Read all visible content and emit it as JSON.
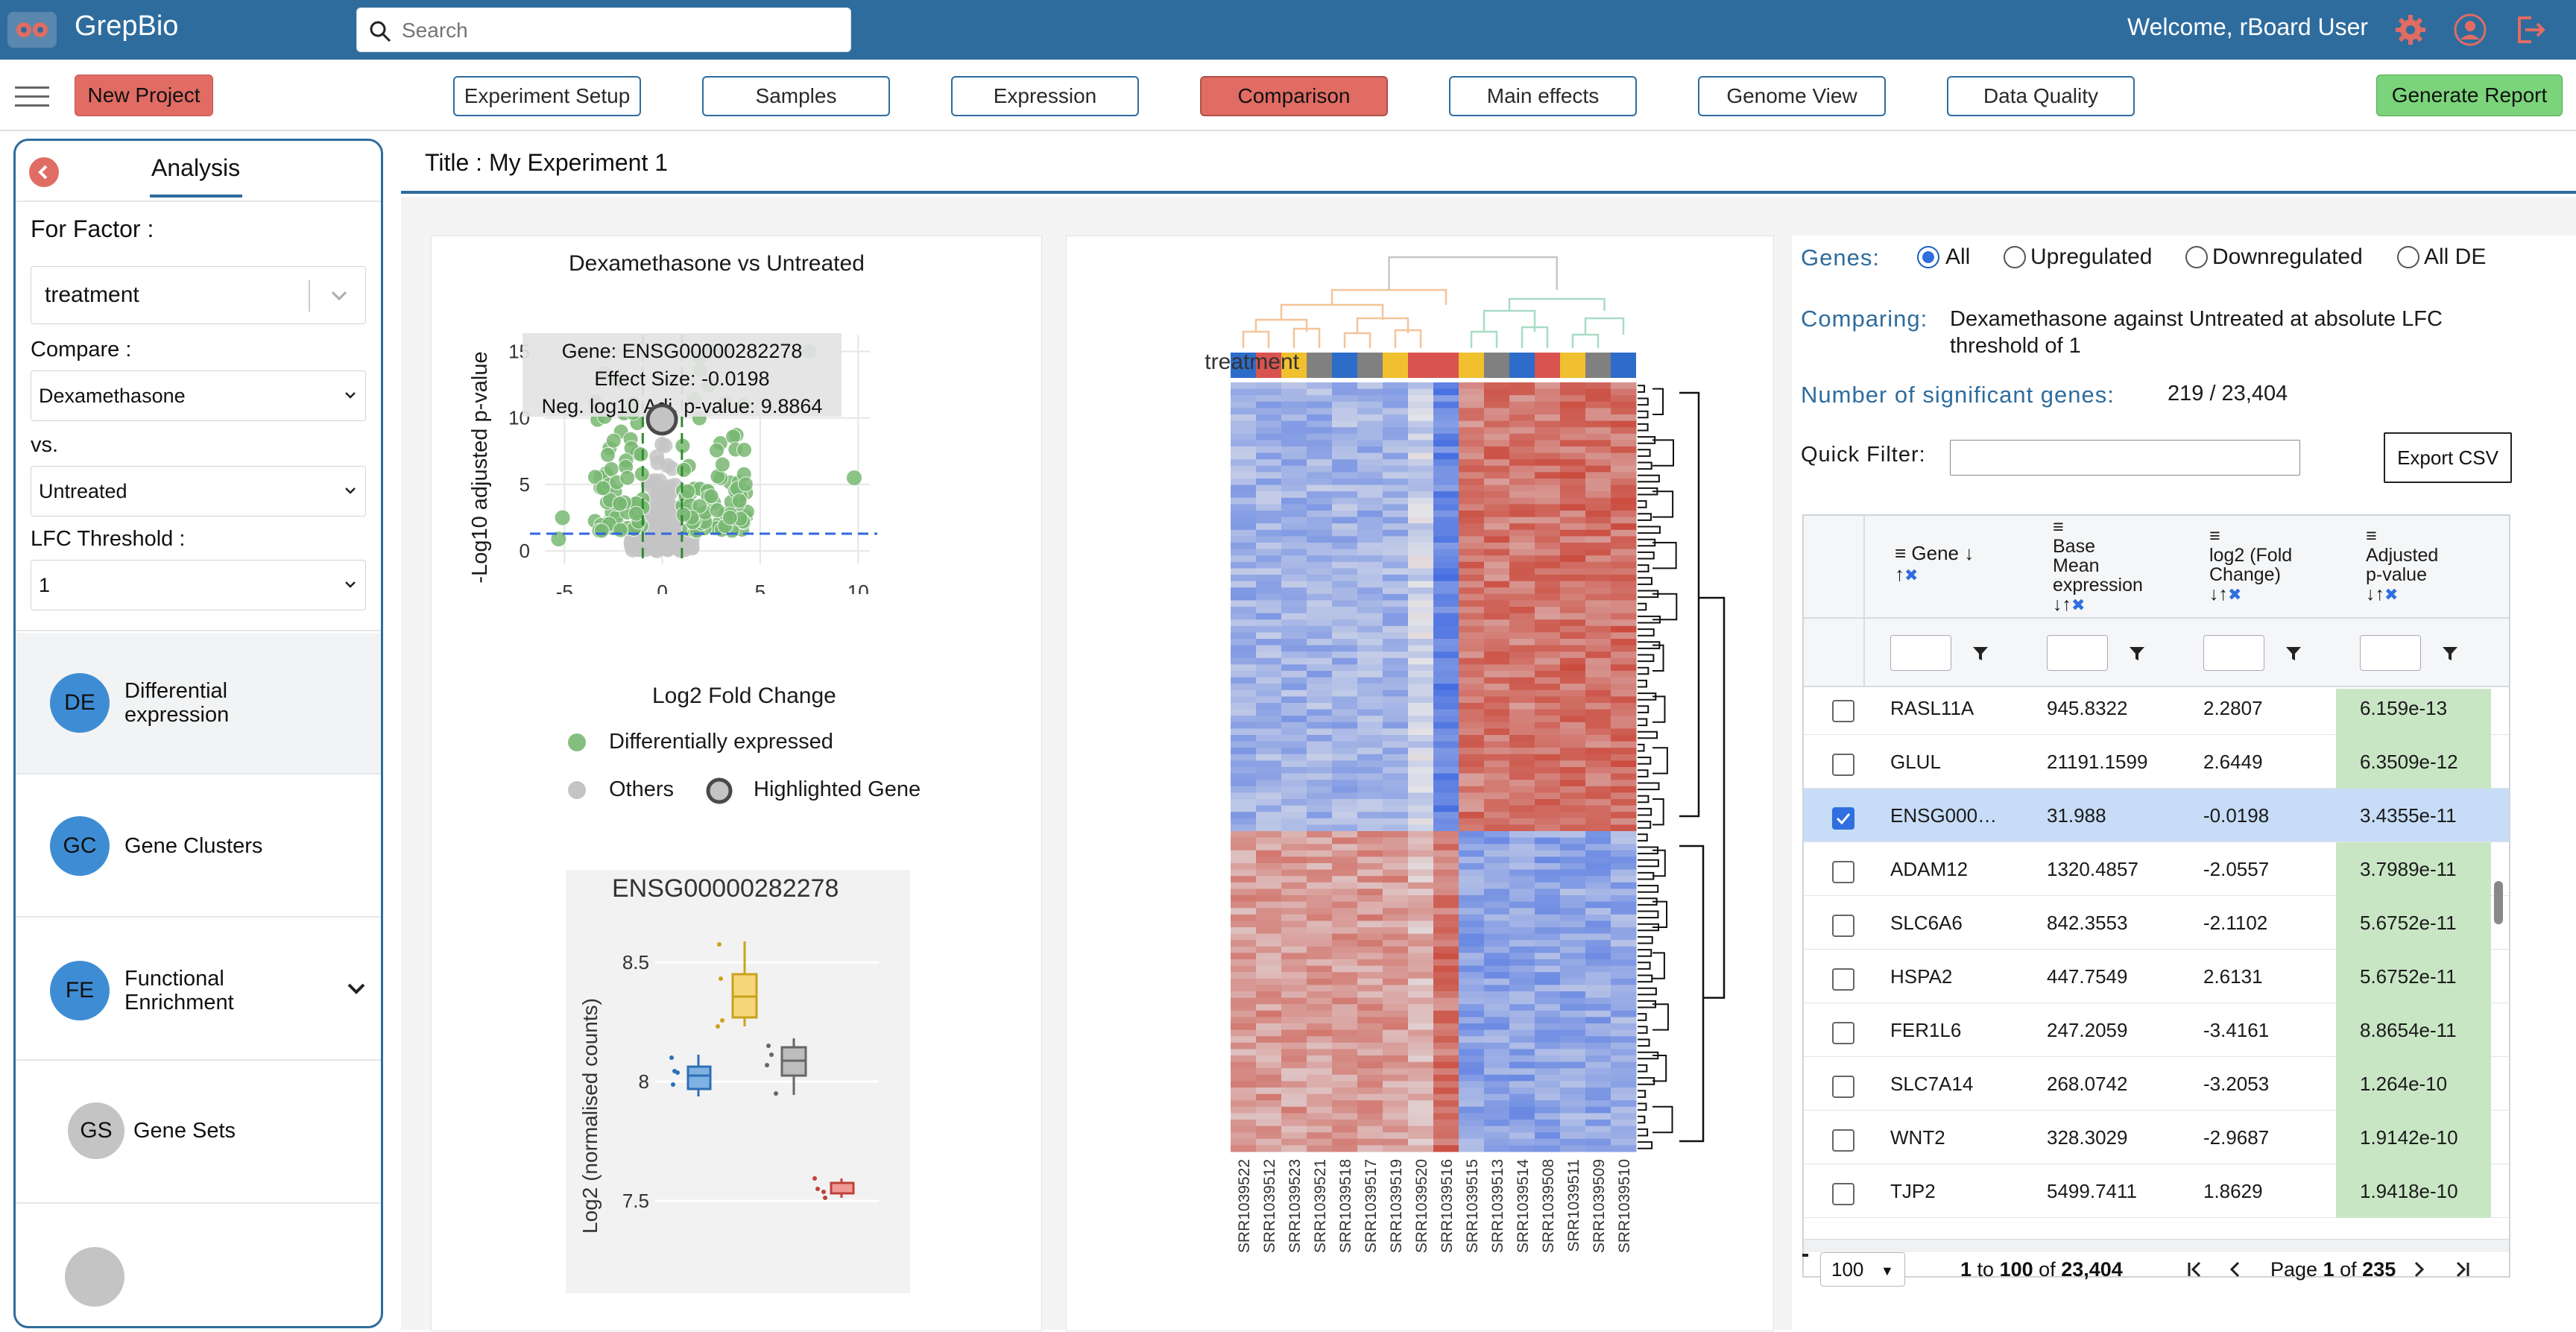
{
  "app": {
    "brand": "GrepBio",
    "welcome": "Welcome, rBoard User"
  },
  "search": {
    "placeholder": "Search"
  },
  "nav": {
    "new_project": "New Project",
    "generate_report": "Generate Report",
    "tabs": [
      {
        "label": "Experiment Setup"
      },
      {
        "label": "Samples"
      },
      {
        "label": "Expression"
      },
      {
        "label": "Comparison",
        "active": true
      },
      {
        "label": "Main effects"
      },
      {
        "label": "Genome View"
      },
      {
        "label": "Data Quality"
      }
    ]
  },
  "sidebar": {
    "title": "Analysis",
    "factor_label": "For Factor :",
    "factor_value": "treatment",
    "compare_label": "Compare :",
    "compare_value": "Dexamethasone",
    "vs_label": "vs.",
    "vs_value": "Untreated",
    "lfc_label": "LFC Threshold :",
    "lfc_value": "1",
    "items": [
      {
        "badge": "DE",
        "line1": "Differential",
        "line2": "expression"
      },
      {
        "badge": "GC",
        "line1": "Gene Clusters",
        "line2": ""
      },
      {
        "badge": "FE",
        "line1": "Functional",
        "line2": "Enrichment"
      },
      {
        "badge": "GS",
        "line1": "Gene Sets",
        "line2": ""
      }
    ]
  },
  "experiment": {
    "title": "Title : My Experiment 1"
  },
  "volcano": {
    "title": "Dexamethasone vs Untreated",
    "xlabel": "Log2 Fold Change",
    "ylabel": "-Log10 adjusted p-value",
    "xticks": [
      "-5",
      "0",
      "5",
      "10"
    ],
    "yticks": [
      "0",
      "5",
      "10",
      "15"
    ],
    "tooltip": {
      "gene": "Gene: ENSG00000282278",
      "effect": "Effect Size: -0.0198",
      "pval": "Neg. log10 Adj. p-value: 9.8864"
    },
    "legend": {
      "de": "Differentially expressed",
      "others": "Others",
      "highlighted": "Highlighted Gene"
    },
    "colors": {
      "de": "#78b872",
      "others": "#c4c4c4",
      "highlight": "#4a4a4a",
      "threshold_h": "#3366e0",
      "threshold_v": "#2e8b2e"
    }
  },
  "boxplot": {
    "title": "ENSG00000282278",
    "ylabel": "Log2 (normalised counts)",
    "yticks": [
      "7.5",
      "8",
      "8.5"
    ],
    "colors": [
      "#4a90d9",
      "#f2c744",
      "#9a9a9a",
      "#e06c63"
    ]
  },
  "heatmap": {
    "row_label": "treatment",
    "samples": [
      "SRR1039522",
      "SRR1039512",
      "SRR1039523",
      "SRR1039521",
      "SRR1039518",
      "SRR1039517",
      "SRR1039519",
      "SRR1039520",
      "SRR1039516",
      "SRR1039515",
      "SRR1039513",
      "SRR1039514",
      "SRR1039508",
      "SRR1039511",
      "SRR1039509",
      "SRR1039510"
    ],
    "annotation_colors": [
      "#2e6cc9",
      "#d9534f",
      "#f0c02f",
      "#808080",
      "#2e6cc9",
      "#808080",
      "#f0c02f",
      "#d9534f",
      "#d9534f",
      "#f0c02f",
      "#808080",
      "#2e6cc9",
      "#d9534f",
      "#f0c02f",
      "#808080",
      "#2e6cc9"
    ]
  },
  "results": {
    "genes_label": "Genes:",
    "filters": [
      {
        "label": "All",
        "checked": true
      },
      {
        "label": "Upregulated",
        "checked": false
      },
      {
        "label": "Downregulated",
        "checked": false
      },
      {
        "label": "All DE",
        "checked": false
      }
    ],
    "comparing_label": "Comparing:",
    "comparing_line1": "Dexamethasone against Untreated at absolute LFC",
    "comparing_line2": "threshold of 1",
    "sig_label": "Number of significant genes:",
    "sig_value": "219 / 23,404",
    "quick_filter_label": "Quick Filter:",
    "export_label": "Export CSV"
  },
  "table": {
    "headers": {
      "gene": "Gene",
      "base_mean": [
        "Base",
        "Mean",
        "expression"
      ],
      "log2fc": [
        "log2 (Fold",
        "Change)"
      ],
      "padj": [
        "Adjusted",
        "p-value"
      ]
    },
    "rows": [
      {
        "gene": "RASL11A",
        "base": "945.8322",
        "lfc": "2.2807",
        "padj": "6.159e-13",
        "sel": false
      },
      {
        "gene": "GLUL",
        "base": "21191.1599",
        "lfc": "2.6449",
        "padj": "6.3509e-12",
        "sel": false
      },
      {
        "gene": "ENSG000…",
        "base": "31.988",
        "lfc": "-0.0198",
        "padj": "3.4355e-11",
        "sel": true
      },
      {
        "gene": "ADAM12",
        "base": "1320.4857",
        "lfc": "-2.0557",
        "padj": "3.7989e-11",
        "sel": false
      },
      {
        "gene": "SLC6A6",
        "base": "842.3553",
        "lfc": "-2.1102",
        "padj": "5.6752e-11",
        "sel": false
      },
      {
        "gene": "HSPA2",
        "base": "447.7549",
        "lfc": "2.6131",
        "padj": "5.6752e-11",
        "sel": false
      },
      {
        "gene": "FER1L6",
        "base": "247.2059",
        "lfc": "-3.4161",
        "padj": "8.8654e-11",
        "sel": false
      },
      {
        "gene": "SLC7A14",
        "base": "268.0742",
        "lfc": "-3.2053",
        "padj": "1.264e-10",
        "sel": false
      },
      {
        "gene": "WNT2",
        "base": "328.3029",
        "lfc": "-2.9687",
        "padj": "1.9142e-10",
        "sel": false
      },
      {
        "gene": "TJP2",
        "base": "5499.7411",
        "lfc": "1.8629",
        "padj": "1.9418e-10",
        "sel": false
      }
    ]
  },
  "pagination": {
    "page_size": "100",
    "range_start": "1",
    "range_to": "to",
    "range_end": "100",
    "range_of": "of",
    "total": "23,404",
    "page_word": "Page",
    "page_num": "1",
    "page_of": "of",
    "page_total": "235"
  }
}
